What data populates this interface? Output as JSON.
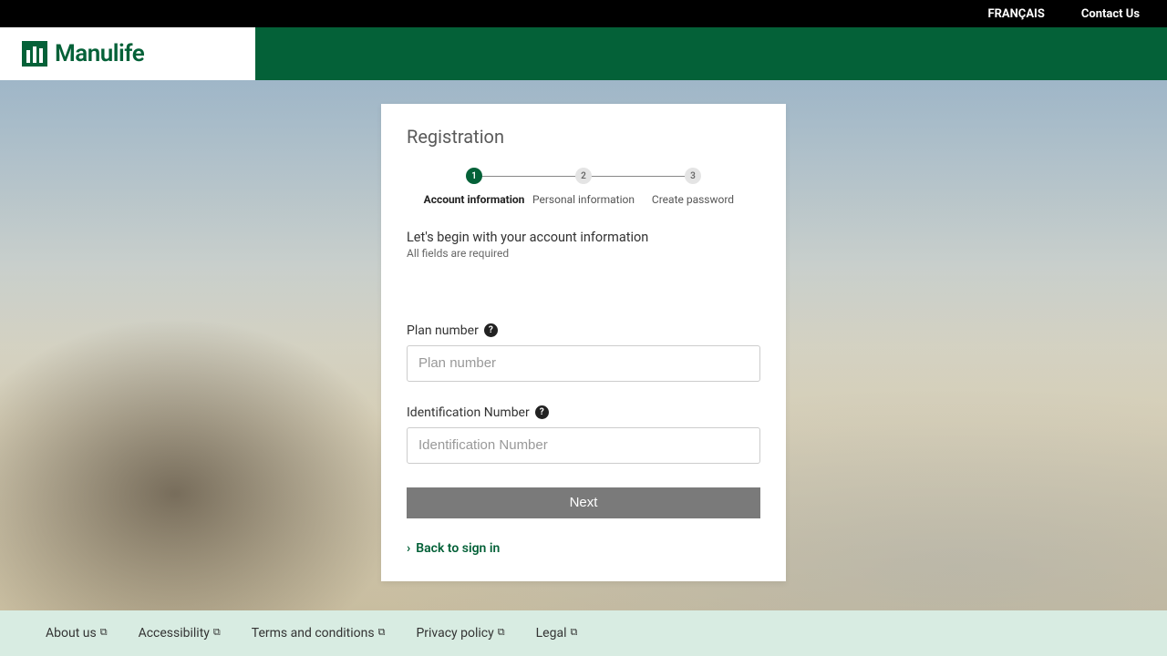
{
  "topbar": {
    "language": "FRANÇAIS",
    "contact": "Contact Us"
  },
  "brand": {
    "name": "Manulife"
  },
  "card": {
    "title": "Registration",
    "steps": [
      {
        "num": "1",
        "label": "Account information"
      },
      {
        "num": "2",
        "label": "Personal information"
      },
      {
        "num": "3",
        "label": "Create password"
      }
    ],
    "lead": "Let's begin with your account information",
    "sub": "All fields are required",
    "plan_label": "Plan number",
    "plan_placeholder": "Plan number",
    "id_label": "Identification Number",
    "id_placeholder": "Identification Number",
    "next": "Next",
    "back": "Back to sign in"
  },
  "footer": {
    "links": [
      "About us",
      "Accessibility",
      "Terms and conditions",
      "Privacy policy",
      "Legal"
    ]
  }
}
